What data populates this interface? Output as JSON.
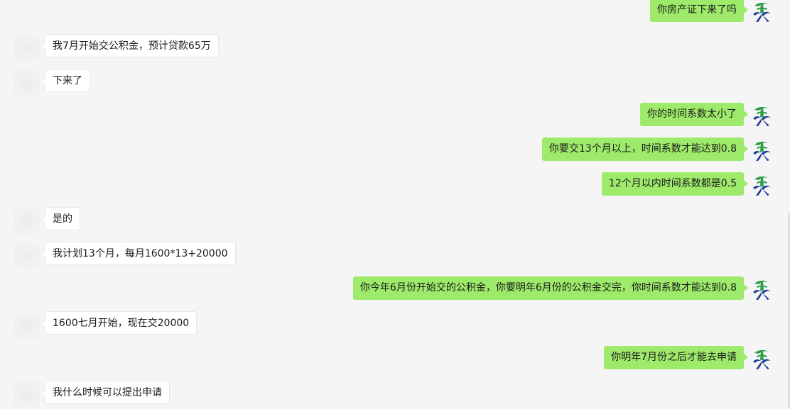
{
  "chat": {
    "messages": [
      {
        "side": "right",
        "text": "你房产证下来了吗"
      },
      {
        "side": "left",
        "text": "我7月开始交公积金，预计贷款65万"
      },
      {
        "side": "left",
        "text": "下来了"
      },
      {
        "side": "right",
        "text": "你的时间系数太小了"
      },
      {
        "side": "right",
        "text": "你要交13个月以上，时间系数才能达到0.8"
      },
      {
        "side": "right",
        "text": "12个月以内时间系数都是0.5"
      },
      {
        "side": "left",
        "text": "是的"
      },
      {
        "side": "left",
        "text": "我计划13个月，每月1600*13+20000"
      },
      {
        "side": "right",
        "text": "你今年6月份开始交的公积金，你要明年6月份的公积金交完，你时间系数才能达到0.8"
      },
      {
        "side": "left",
        "text": "1600七月开始，现在交20000"
      },
      {
        "side": "right",
        "text": "你明年7月份之后才能去申请"
      },
      {
        "side": "left",
        "text": "我什么时候可以提出申请"
      }
    ]
  },
  "colors": {
    "background": "#f5f5f5",
    "outgoing_bubble": "#9eea6a",
    "incoming_bubble": "#ffffff",
    "logo_green": "#2e9e4a",
    "logo_blue": "#1f3d9a"
  },
  "icons": {
    "self_avatar": "green-blue-logo-icon",
    "other_avatar": "blurred-avatar"
  }
}
